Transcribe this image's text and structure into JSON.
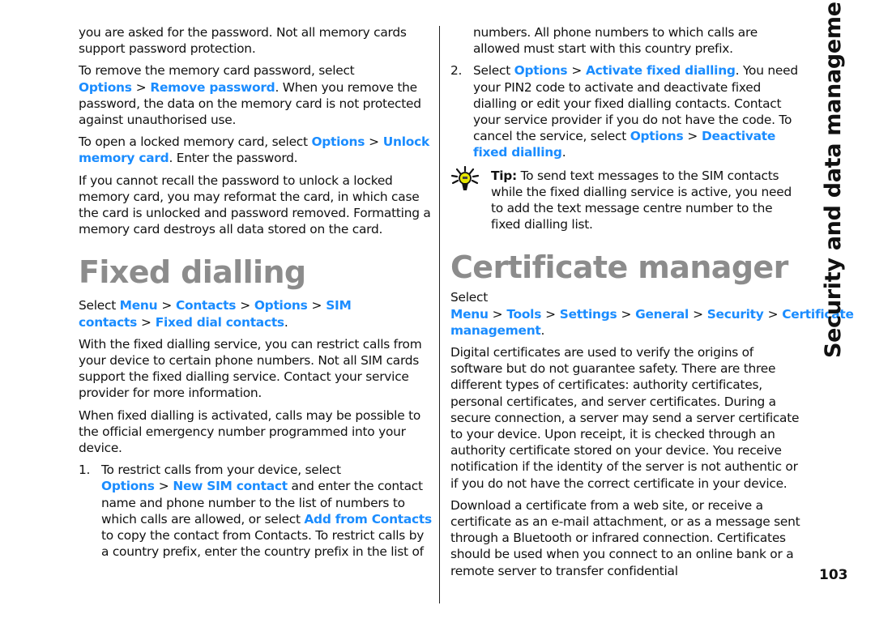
{
  "side_title": "Security and data management",
  "page_number": "103",
  "left": {
    "p1": "you are asked for the password. Not all memory cards support password protection.",
    "p2": {
      "pre": "To remove the memory card password, select",
      "link1": "Options",
      "link2": "Remove password",
      "post": ". When you remove the password, the data on the memory card is not protected against unauthorised use."
    },
    "p3": {
      "pre": "To open a locked memory card, select",
      "link1": "Options",
      "link2": "Unlock memory card",
      "post": ". Enter the password."
    },
    "p4": "If you cannot recall the password to unlock a locked memory card, you may reformat the card, in which case the card is unlocked and password removed. Formatting a memory card destroys all data stored on the card.",
    "heading": "Fixed dialling",
    "path": {
      "pre": "Select",
      "items": [
        "Menu",
        "Contacts",
        "Options",
        "SIM contacts",
        "Fixed dial contacts"
      ],
      "post": "."
    },
    "p5": "With the fixed dialling service, you can restrict calls from your device to certain phone numbers. Not all SIM cards support the fixed dialling service. Contact your service provider for more information.",
    "p6": "When fixed dialling is activated, calls may be possible to the official emergency number programmed into your device.",
    "step1": {
      "num": "1.",
      "pre": "To restrict calls from your device, select",
      "link1": "Options",
      "link2": "New SIM contact",
      "mid": " and enter the contact name and phone number to the list of numbers to which calls are allowed, or select ",
      "link3": "Add from Contacts",
      "post": " to copy the contact from Contacts. To restrict calls by a country prefix, enter the country prefix in the list of"
    }
  },
  "right": {
    "step1_cont": "numbers. All phone numbers to which calls are allowed must start with this country prefix.",
    "step2": {
      "num": "2.",
      "pre": "Select",
      "link1": "Options",
      "link2": "Activate fixed dialling",
      "mid": ". You need your PIN2 code to activate and deactivate fixed dialling or edit your fixed dialling contacts. Contact your service provider if you do not have the code. To cancel the service, select ",
      "link3": "Options",
      "link4": "Deactivate fixed dialling",
      "post": "."
    },
    "tip": {
      "label": "Tip:",
      "text": " To send text messages to the SIM contacts while the fixed dialling service is active, you need to add the text message centre number to the fixed dialling list.",
      "icon": "lightbulb-icon"
    },
    "heading": "Certificate manager",
    "path": {
      "pre": "Select",
      "items": [
        "Menu",
        "Tools",
        "Settings",
        "General",
        "Security",
        "Certificate management"
      ],
      "post": "."
    },
    "p1": "Digital certificates are used to verify the origins of software but do not guarantee safety. There are three different types of certificates: authority certificates, personal certificates, and server certificates. During a secure connection, a server may send a server certificate to your device. Upon receipt, it is checked through an authority certificate stored on your device. You receive notification if the identity of the server is not authentic or if you do not have the correct certificate in your device.",
    "p2": "Download a certificate from a web site, or receive a certificate as an e-mail attachment, or as a message sent through a Bluetooth or infrared connection. Certificates should be used when you connect to an online bank or a remote server to transfer confidential"
  },
  "colors": {
    "link": "#1a8cff",
    "heading": "#8c8c8c",
    "text": "#111111"
  },
  "separator": ">"
}
